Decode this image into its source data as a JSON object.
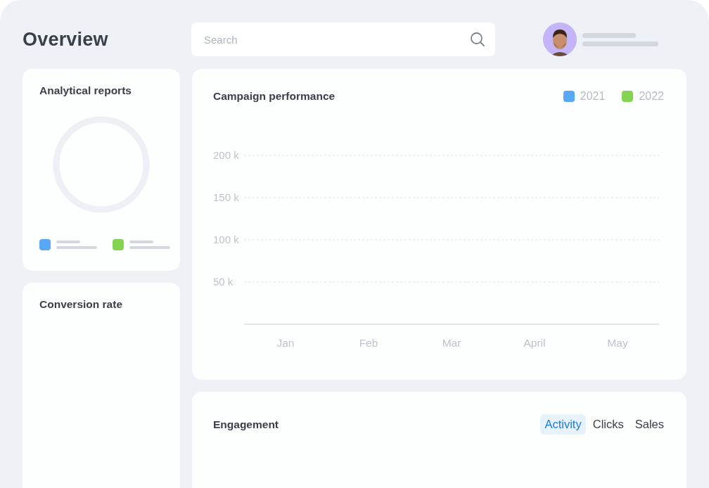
{
  "header": {
    "title": "Overview",
    "search": {
      "placeholder": "Search"
    },
    "user": {
      "kind": "avatar"
    }
  },
  "analytical_reports": {
    "title": "Analytical reports",
    "legend": [
      {
        "color": "#58a8f8"
      },
      {
        "color": "#84d454"
      }
    ]
  },
  "conversion_rate": {
    "title": "Conversion rate"
  },
  "campaign_performance": {
    "title": "Campaign performance",
    "chart_data": {
      "type": "line",
      "grid": true,
      "categories": [
        "Jan",
        "Feb",
        "Mar",
        "April",
        "May"
      ],
      "ylim": [
        0,
        200000
      ],
      "yticks": [
        {
          "value": 50000,
          "label": "50 k"
        },
        {
          "value": 100000,
          "label": "100 k"
        },
        {
          "value": 150000,
          "label": "150 k"
        },
        {
          "value": 200000,
          "label": "200 k"
        }
      ],
      "series": [
        {
          "name": "2021",
          "color": "#58a8f8",
          "values": [
            null,
            null,
            null,
            null,
            null
          ]
        },
        {
          "name": "2022",
          "color": "#84d454",
          "values": [
            null,
            null,
            null,
            null,
            null
          ]
        }
      ]
    }
  },
  "engagement": {
    "title": "Engagement",
    "tabs": [
      {
        "label": "Activity",
        "selected": true
      },
      {
        "label": "Clicks",
        "selected": false
      },
      {
        "label": "Sales",
        "selected": false
      }
    ]
  }
}
